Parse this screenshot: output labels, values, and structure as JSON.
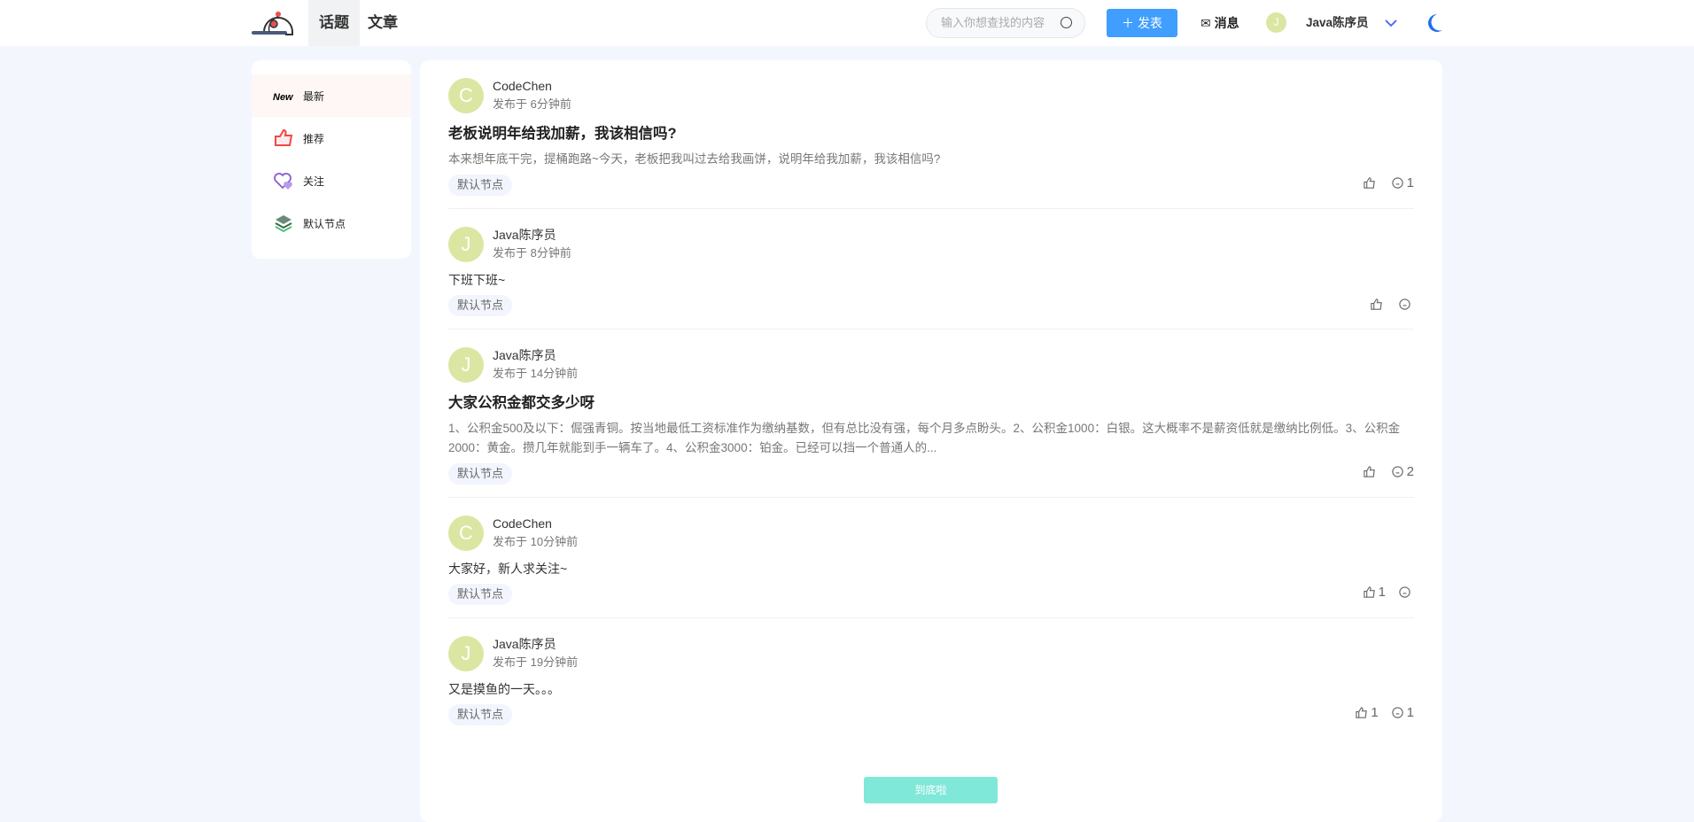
{
  "header": {
    "nav": [
      "话题",
      "文章"
    ],
    "active_nav": 0,
    "search_placeholder": "输入你想查找的内容",
    "publish_label": "发表",
    "messages_label": "消息",
    "user_initial": "J",
    "user_name": "Java陈序员"
  },
  "sidebar": {
    "items": [
      {
        "label": "最新",
        "icon": "new-icon",
        "active": true
      },
      {
        "label": "推荐",
        "icon": "thumbs-up-icon"
      },
      {
        "label": "关注",
        "icon": "hearts-icon"
      },
      {
        "label": "默认节点",
        "icon": "layers-icon"
      }
    ]
  },
  "posts": [
    {
      "initial": "C",
      "author": "CodeChen",
      "time": "发布于 6分钟前",
      "title": "老板说明年给我加薪，我该相信吗?",
      "excerpt": "本来想年底干完，提桶跑路~今天，老板把我叫过去给我画饼，说明年给我加薪，我该相信吗?",
      "tag": "默认节点",
      "likes": "",
      "comments": "1"
    },
    {
      "initial": "J",
      "author": "Java陈序员",
      "time": "发布于 8分钟前",
      "text": "下班下班~",
      "tag": "默认节点",
      "likes": "",
      "comments": ""
    },
    {
      "initial": "J",
      "author": "Java陈序员",
      "time": "发布于 14分钟前",
      "title": "大家公积金都交多少呀",
      "excerpt": "1、公积金500及以下：倔强青铜。按当地最低工资标准作为缴纳基数，但有总比没有强，每个月多点盼头。2、公积金1000：白银。这大概率不是薪资低就是缴纳比例低。3、公积金2000：黄金。攒几年就能到手一辆车了。4、公积金3000：铂金。已经可以挡一个普通人的...",
      "tag": "默认节点",
      "likes": "",
      "comments": "2"
    },
    {
      "initial": "C",
      "author": "CodeChen",
      "time": "发布于 10分钟前",
      "text": "大家好，新人求关注~",
      "tag": "默认节点",
      "likes": "1",
      "comments": ""
    },
    {
      "initial": "J",
      "author": "Java陈序员",
      "time": "发布于 19分钟前",
      "text": "又是摸鱼的一天。。。",
      "tag": "默认节点",
      "likes": "1",
      "comments": "1"
    }
  ],
  "end_label": "到底啦",
  "colors": {
    "primary": "#409eff",
    "end_button": "#80e8d8",
    "avatar": "#dbe6a2"
  }
}
